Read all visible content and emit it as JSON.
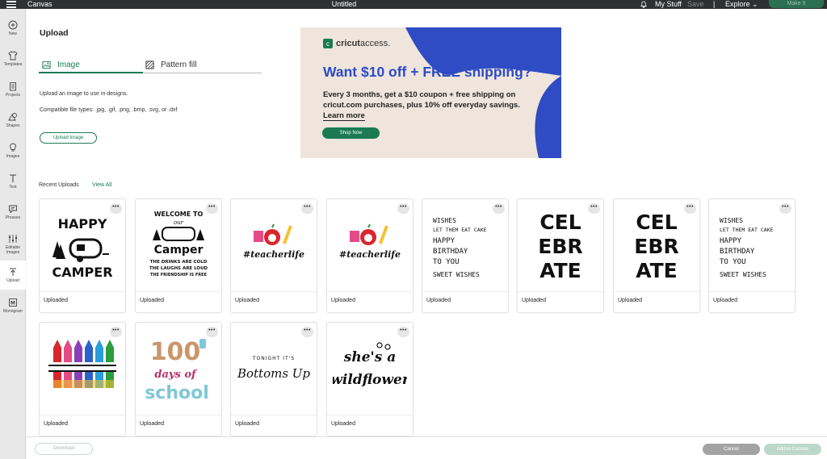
{
  "topbar": {
    "app_name": "Canvas",
    "document_title": "Untitled",
    "my_stuff": "My Stuff",
    "save": "Save",
    "separator": "|",
    "explore": "Explore",
    "make_it": "Make It"
  },
  "sidebar": {
    "items": [
      {
        "label": "New",
        "icon": "plus-circle-icon"
      },
      {
        "label": "Templates",
        "icon": "shirt-icon"
      },
      {
        "label": "Projects",
        "icon": "clipboard-icon"
      },
      {
        "label": "Shapes",
        "icon": "shapes-icon"
      },
      {
        "label": "Images",
        "icon": "lightbulb-icon"
      },
      {
        "label": "Text",
        "icon": "text-icon"
      },
      {
        "label": "Phrases",
        "icon": "speech-bubble-icon"
      },
      {
        "label": "Editable Images",
        "icon": "editable-images-icon"
      },
      {
        "label": "Upload",
        "icon": "upload-icon"
      },
      {
        "label": "Monogram",
        "icon": "monogram-icon"
      }
    ],
    "active": "Upload"
  },
  "upload_panel": {
    "heading": "Upload",
    "tabs": [
      {
        "label": "Image",
        "icon": "image-icon",
        "active": true
      },
      {
        "label": "Pattern fill",
        "icon": "pattern-icon",
        "active": false
      }
    ],
    "description": "Upload an image to use in designs.",
    "file_types": "Compatible file types: .jpg, .gif, .png, .bmp, .svg, or .dxf",
    "upload_button": "Upload Image"
  },
  "ad": {
    "brand_a": "cricut",
    "brand_b": "access.",
    "headline": "Want $10 off + FREE shipping?",
    "body": "Every 3 months, get a $10 coupon + free shipping on cricut.com purchases, plus 10% off everyday savings.",
    "learn_more": "Learn more",
    "cta": "Shop Now",
    "colors": {
      "background": "#efe5dc",
      "blue": "#2f4cc4",
      "green": "#1b7a52"
    }
  },
  "recent": {
    "label": "Recent Uploads",
    "view_all": "View All",
    "more_label": "•••",
    "items": [
      {
        "caption": "Uploaded",
        "design": "happy-camper",
        "lines": [
          "HAPPY",
          "CAMPER"
        ]
      },
      {
        "caption": "Uploaded",
        "design": "welcome-camper",
        "lines": [
          "WELCOME TO",
          "our",
          "Camper",
          "THE DRINKS ARE COLD",
          "THE LAUGHS ARE LOUD",
          "THE FRIENDSHIP IS FREE"
        ]
      },
      {
        "caption": "Uploaded",
        "design": "teacherlife",
        "lines": [
          "#teacherlife"
        ]
      },
      {
        "caption": "Uploaded",
        "design": "teacherlife",
        "lines": [
          "#teacherlife"
        ]
      },
      {
        "caption": "Uploaded",
        "design": "birthday-wishes",
        "lines": [
          "WISHES",
          "LET THEM EAT CAKE",
          "HAPPY",
          "BIRTHDAY",
          "TO YOU",
          "SWEET WISHES"
        ]
      },
      {
        "caption": "Uploaded",
        "design": "celebrate",
        "lines": [
          "CEL",
          "EBR",
          "ATE"
        ]
      },
      {
        "caption": "Uploaded",
        "design": "celebrate",
        "lines": [
          "CEL",
          "EBR",
          "ATE"
        ]
      },
      {
        "caption": "Uploaded",
        "design": "birthday-wishes",
        "lines": [
          "WISHES",
          "LET THEM EAT CAKE",
          "HAPPY",
          "BIRTHDAY",
          "TO YOU",
          "SWEET WISHES"
        ]
      },
      {
        "caption": "Uploaded",
        "design": "crayons",
        "lines": []
      },
      {
        "caption": "Uploaded",
        "design": "100-days",
        "lines": [
          "100",
          "days of",
          "school"
        ]
      },
      {
        "caption": "Uploaded",
        "design": "bottoms-up",
        "lines": [
          "TONIGHT IT'S",
          "Bottoms Up"
        ]
      },
      {
        "caption": "Uploaded",
        "design": "wildflower",
        "lines": [
          "she's a",
          "wildflower"
        ]
      }
    ]
  },
  "bottombar": {
    "download": "Download",
    "cancel": "Cancel",
    "add_to_canvas": "Add to Canvas"
  }
}
